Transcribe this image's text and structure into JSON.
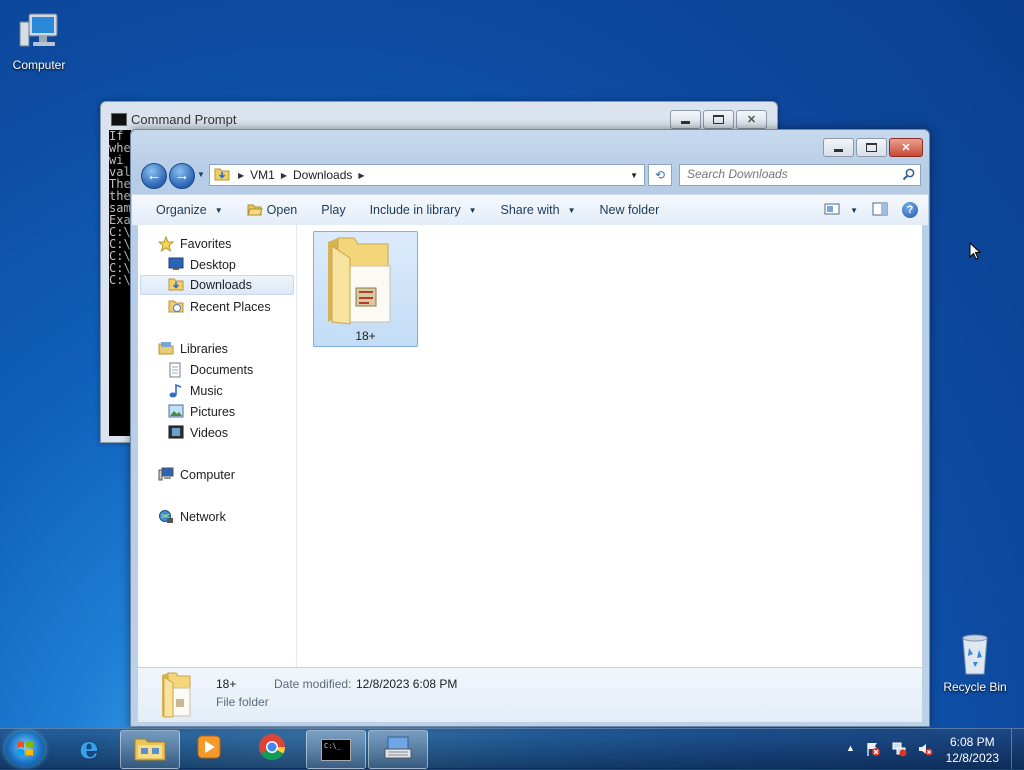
{
  "desktop": {
    "icons": [
      {
        "label": "Computer",
        "icon": "computer-icon"
      },
      {
        "label": "Recycle Bin",
        "icon": "recycle-bin-icon"
      }
    ]
  },
  "cmd_window": {
    "title": "Command Prompt",
    "console_lines": [
      "If",
      "whe",
      "wi",
      "val",
      "",
      "The",
      "the",
      "sam",
      "",
      "Exa",
      "",
      "C:\\",
      "",
      "C:\\",
      "",
      "C:\\",
      "",
      "C:\\",
      "",
      "C:\\"
    ]
  },
  "explorer": {
    "breadcrumb": [
      "VM1",
      "Downloads"
    ],
    "search_placeholder": "Search Downloads",
    "toolbar": {
      "organize": "Organize",
      "open": "Open",
      "play": "Play",
      "include": "Include in library",
      "share": "Share with",
      "new_folder": "New folder"
    },
    "nav": {
      "favorites": "Favorites",
      "desktop": "Desktop",
      "downloads": "Downloads",
      "recent": "Recent Places",
      "libraries": "Libraries",
      "documents": "Documents",
      "music": "Music",
      "pictures": "Pictures",
      "videos": "Videos",
      "computer": "Computer",
      "network": "Network"
    },
    "files": [
      {
        "name": "18+",
        "type": "folder"
      }
    ],
    "details": {
      "name": "18+",
      "type": "File folder",
      "date_label": "Date modified:",
      "date_value": "12/8/2023 6:08 PM"
    }
  },
  "taskbar": {
    "time": "6:08 PM",
    "date": "12/8/2023",
    "cmd_label": "C:\\_"
  }
}
